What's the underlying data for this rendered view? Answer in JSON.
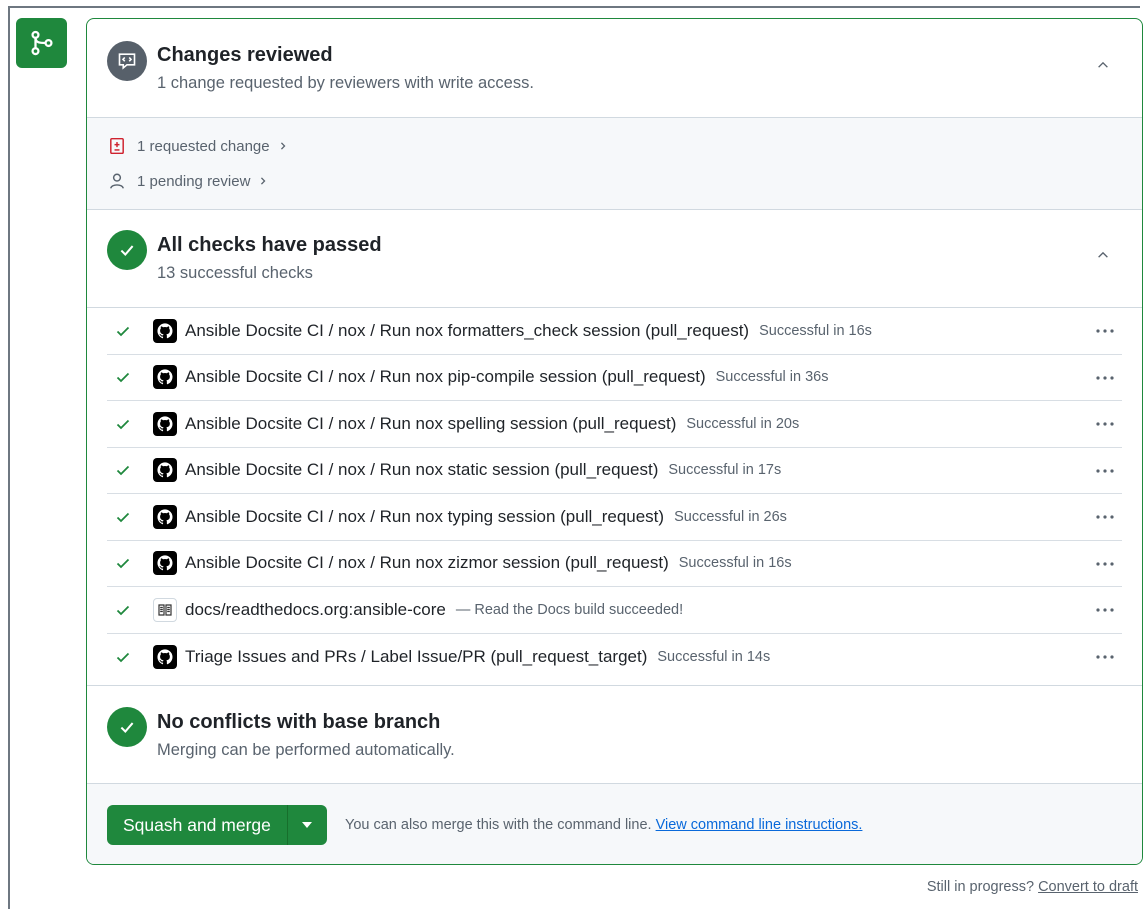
{
  "reviews": {
    "title": "Changes reviewed",
    "subtitle": "1 change requested by reviewers with write access.",
    "requested_change_label": "1 requested change",
    "pending_review_label": "1 pending review"
  },
  "checks": {
    "title": "All checks have passed",
    "subtitle": "13 successful checks",
    "items": [
      {
        "name": "Ansible Docsite CI / nox / Run nox formatters_check session (pull_request)",
        "status": "Successful in 16s",
        "icon": "github-icon"
      },
      {
        "name": "Ansible Docsite CI / nox / Run nox pip-compile session (pull_request)",
        "status": "Successful in 36s",
        "icon": "github-icon"
      },
      {
        "name": "Ansible Docsite CI / nox / Run nox spelling session (pull_request)",
        "status": "Successful in 20s",
        "icon": "github-icon"
      },
      {
        "name": "Ansible Docsite CI / nox / Run nox static session (pull_request)",
        "status": "Successful in 17s",
        "icon": "github-icon"
      },
      {
        "name": "Ansible Docsite CI / nox / Run nox typing session (pull_request)",
        "status": "Successful in 26s",
        "icon": "github-icon"
      },
      {
        "name": "Ansible Docsite CI / nox / Run nox zizmor session (pull_request)",
        "status": "Successful in 16s",
        "icon": "github-icon"
      },
      {
        "name": "docs/readthedocs.org:ansible-core",
        "status": "— Read the Docs build succeeded!",
        "icon": "readthedocs-icon"
      },
      {
        "name": "Triage Issues and PRs / Label Issue/PR (pull_request_target)",
        "status": "Successful in 14s",
        "icon": "github-icon"
      }
    ]
  },
  "conflicts": {
    "title": "No conflicts with base branch",
    "subtitle": "Merging can be performed automatically."
  },
  "merge": {
    "button_label": "Squash and merge",
    "note_text": "You can also merge this with the command line.",
    "note_link": "View command line instructions."
  },
  "footer": {
    "text": "Still in progress?",
    "link": "Convert to draft"
  },
  "colors": {
    "success_green": "#1f883d",
    "muted_gray": "#57606a",
    "link_blue": "#0969da",
    "danger_red": "#cf222e"
  }
}
